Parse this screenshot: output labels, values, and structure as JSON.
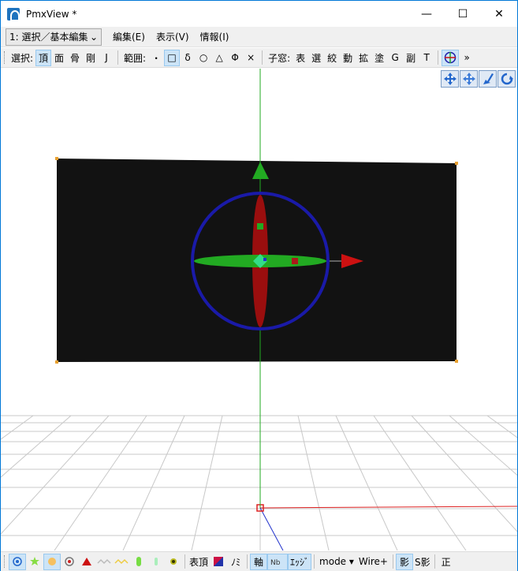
{
  "window": {
    "title": "PmxView *",
    "minimize": "—",
    "maximize": "☐",
    "close": "✕"
  },
  "menubar": {
    "mode_select": "1: 選択／基本編集",
    "items": [
      "編集(E)",
      "表示(V)",
      "情報(I)"
    ]
  },
  "toolbar": {
    "select_label": "選択:",
    "select_items": [
      "頂",
      "面",
      "骨",
      "剛",
      "J"
    ],
    "range_label": "範囲:",
    "range_items": [
      "・",
      "□",
      "δ",
      "○",
      "△",
      "Φ",
      "×"
    ],
    "subwin_label": "子窓:",
    "subwin_items": [
      "表",
      "選",
      "絞",
      "動",
      "拡",
      "塗",
      "G",
      "副",
      "T"
    ],
    "overflow": "»"
  },
  "statusbar": {
    "vertex_label": "表頂",
    "no_label": "ﾉﾐ",
    "axis_label": "軸",
    "edge_label": "ｴｯｼﾞ",
    "mode_label": "mode",
    "wire_label": "Wire+",
    "shadow_label": "影",
    "sshadow_label": "S影",
    "sei_label": "正"
  },
  "colors": {
    "accent": "#0078d7",
    "plane": "#121212",
    "gizmo_x": "#cc1111",
    "gizmo_y": "#22aa22",
    "gizmo_ring": "#1a1aa8"
  }
}
